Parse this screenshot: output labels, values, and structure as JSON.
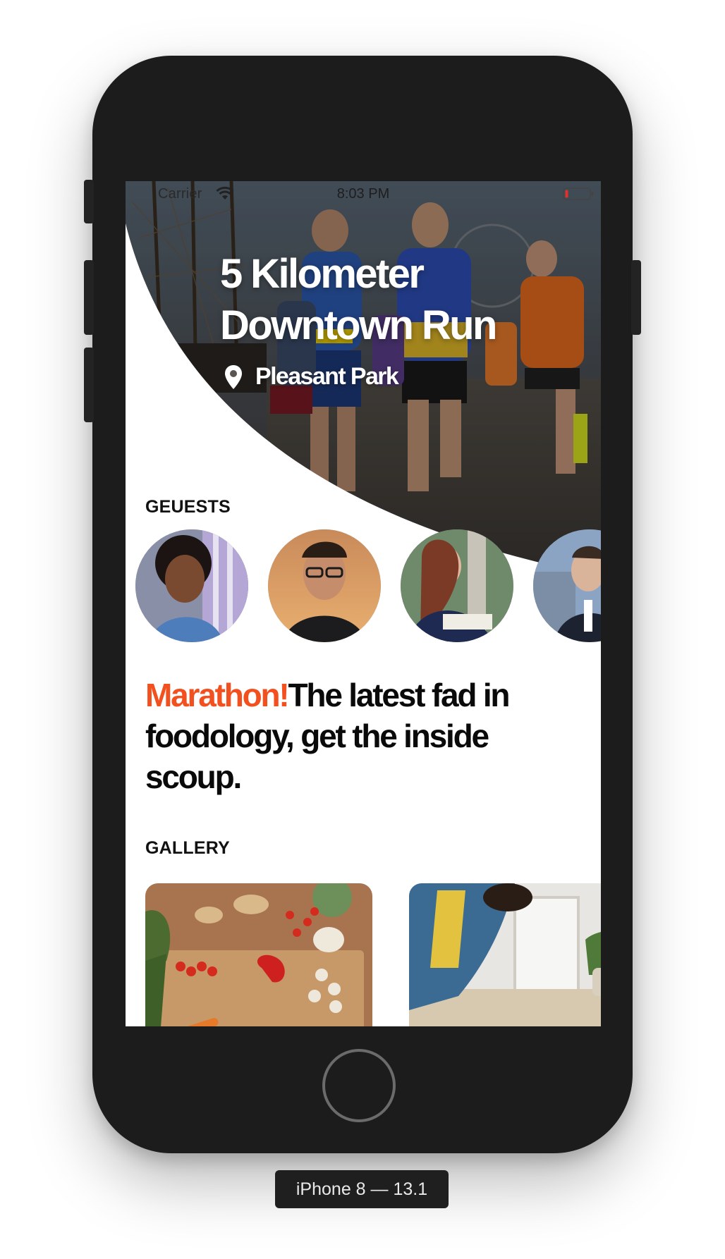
{
  "status_bar": {
    "carrier": "Carrier",
    "time": "8:03 PM",
    "wifi_icon": "wifi-icon",
    "battery_icon": "battery-low-icon",
    "battery_color": "#e0312a"
  },
  "hero": {
    "title": "5 Kilometer Downtown Run",
    "location_icon": "map-pin-icon",
    "location": "Pleasant Park"
  },
  "guests": {
    "label": "GEUESTS",
    "avatars": [
      "guest-avatar-1",
      "guest-avatar-2",
      "guest-avatar-3",
      "guest-avatar-4"
    ]
  },
  "headline": {
    "accent": "Marathon!",
    "text": "The latest fad in foodology, get the inside scoup."
  },
  "gallery": {
    "label": "GALLERY",
    "images": [
      "gallery-image-cutting-board",
      "gallery-image-cooking"
    ]
  },
  "device": {
    "label": "iPhone 8 — 13.1"
  },
  "colors": {
    "accent": "#f2501f",
    "phone_body": "#1c1c1c",
    "text": "#0a0a0a"
  }
}
